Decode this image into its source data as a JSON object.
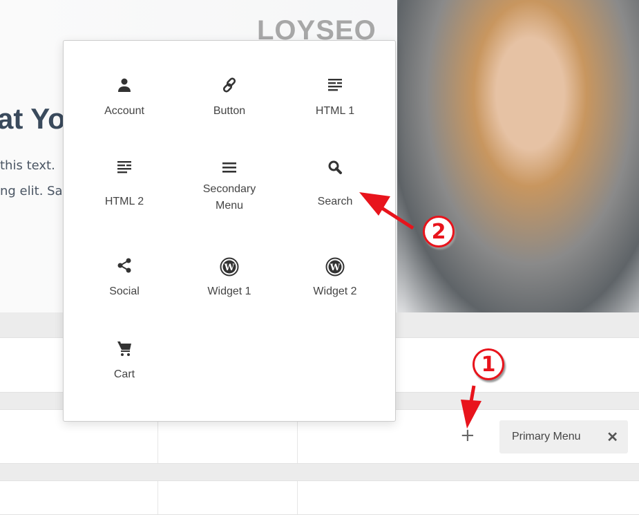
{
  "hero": {
    "title": "at Yo",
    "line1": "this text.",
    "line2": "ng elit. Sa"
  },
  "watermark": "LOYSEO",
  "popup": {
    "items": [
      {
        "label": "Account",
        "icon": "user-icon"
      },
      {
        "label": "Button",
        "icon": "link-icon"
      },
      {
        "label": "HTML 1",
        "icon": "html-icon"
      },
      {
        "label": "HTML 2",
        "icon": "html-icon"
      },
      {
        "label": "Secondary Menu",
        "icon": "menu-icon"
      },
      {
        "label": "Search",
        "icon": "search-icon"
      },
      {
        "label": "Social",
        "icon": "share-icon"
      },
      {
        "label": "Widget 1",
        "icon": "wordpress-icon"
      },
      {
        "label": "Widget 2",
        "icon": "wordpress-icon"
      },
      {
        "label": "Cart",
        "icon": "cart-icon"
      }
    ]
  },
  "builder": {
    "add_label": "+",
    "chip_label": "Primary Menu",
    "chip_close": "✕"
  },
  "annotations": {
    "step1": "1",
    "step2": "2",
    "color": "#e8141c"
  }
}
